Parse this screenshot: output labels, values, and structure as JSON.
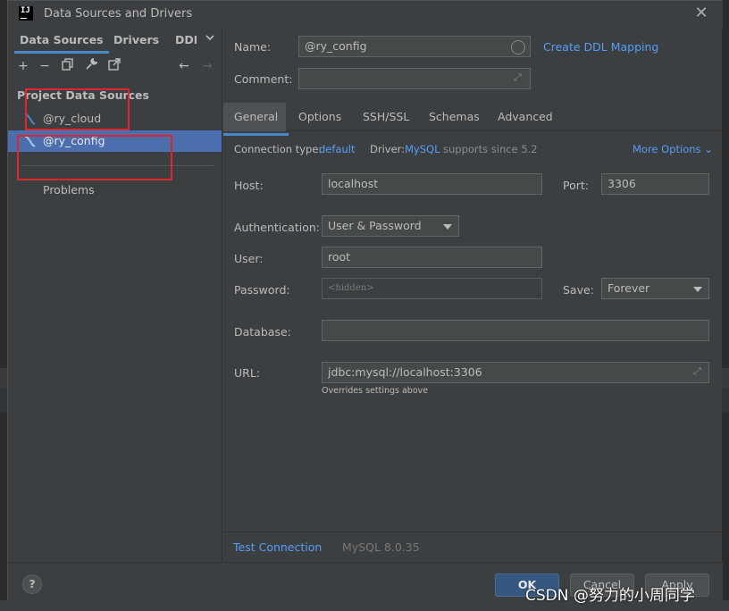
{
  "window": {
    "title": "Data Sources and Drivers",
    "app_logo_text": "IJ"
  },
  "left_panel": {
    "tabs": [
      "Data Sources",
      "Drivers",
      "DDL"
    ],
    "section_title": "Project Data Sources",
    "data_sources": [
      {
        "label": "@ry_cloud",
        "selected": false
      },
      {
        "label": "@ry_config",
        "selected": true
      }
    ],
    "problems_label": "Problems"
  },
  "right_panel": {
    "name_label": "Name:",
    "name_value": "@ry_config",
    "create_ddl_link": "Create DDL Mapping",
    "comment_label": "Comment:",
    "comment_value": "",
    "tabs": [
      "General",
      "Options",
      "SSH/SSL",
      "Schemas",
      "Advanced"
    ],
    "active_tab": "General",
    "connection_type_label": "Connection type:",
    "connection_type_value": "default",
    "driver_label": "Driver:",
    "driver_value": "MySQL",
    "driver_suffix": "supports since 5.2",
    "more_options": "More Options",
    "host_label": "Host:",
    "host_value": "localhost",
    "port_label": "Port:",
    "port_value": "3306",
    "auth_label": "Authentication:",
    "auth_value": "User & Password",
    "user_label": "User:",
    "user_value": "root",
    "password_label": "Password:",
    "password_placeholder": "<hidden>",
    "save_label": "Save:",
    "save_value": "Forever",
    "database_label": "Database:",
    "database_value": "",
    "url_label": "URL:",
    "url_value": "jdbc:mysql://localhost:3306",
    "url_hint": "Overrides settings above",
    "test_connection": "Test Connection",
    "server_version": "MySQL 8.0.35"
  },
  "footer": {
    "help": "?",
    "ok": "OK",
    "cancel": "Cancel",
    "apply": "Apply"
  },
  "watermark": "CSDN @努力的小周同学",
  "colors": {
    "accent": "#4a88c7",
    "selection": "#4b6eaf",
    "link": "#589df6",
    "annotation": "#e0252d"
  }
}
